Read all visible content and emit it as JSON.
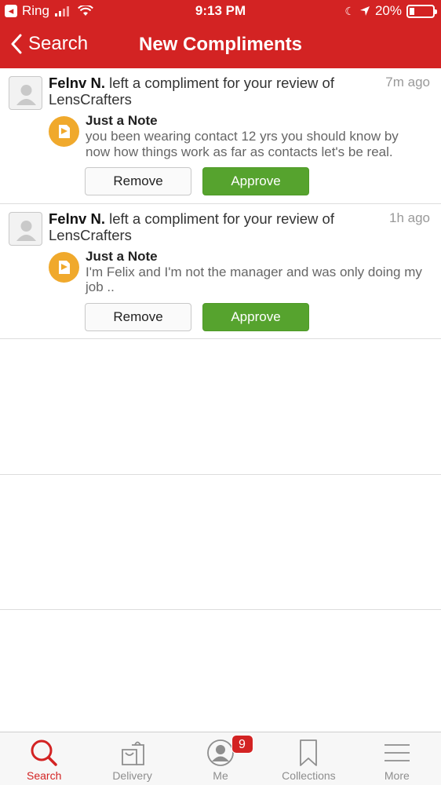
{
  "status_bar": {
    "back_app": "Ring",
    "time": "9:13 PM",
    "battery": "20%",
    "battery_level": 0.2
  },
  "nav": {
    "back_label": "Search",
    "title": "New Compliments"
  },
  "compliments": [
    {
      "user": "Felnv N.",
      "message": " left a compliment for your review of LensCrafters",
      "time": "7m ago",
      "note_title": "Just a Note",
      "note_text": "you been wearing contact 12 yrs you should know by now how things work as far as contacts let's be real.",
      "remove_label": "Remove",
      "approve_label": "Approve"
    },
    {
      "user": "Felnv N.",
      "message": " left a compliment for your review of LensCrafters",
      "time": "1h ago",
      "note_title": "Just a Note",
      "note_text": "I'm Felix and I'm not the manager and was only doing my job ..",
      "remove_label": "Remove",
      "approve_label": "Approve"
    }
  ],
  "tabbar": {
    "items": [
      {
        "label": "Search",
        "icon": "search-icon",
        "active": true
      },
      {
        "label": "Delivery",
        "icon": "shopping-bag-icon",
        "active": false
      },
      {
        "label": "Me",
        "icon": "profile-icon",
        "active": false,
        "badge": "9"
      },
      {
        "label": "Collections",
        "icon": "bookmark-icon",
        "active": false
      },
      {
        "label": "More",
        "icon": "menu-icon",
        "active": false
      }
    ]
  },
  "colors": {
    "brand_red": "#d32323",
    "approve_green": "#56a32e",
    "note_orange": "#f0a92c"
  }
}
